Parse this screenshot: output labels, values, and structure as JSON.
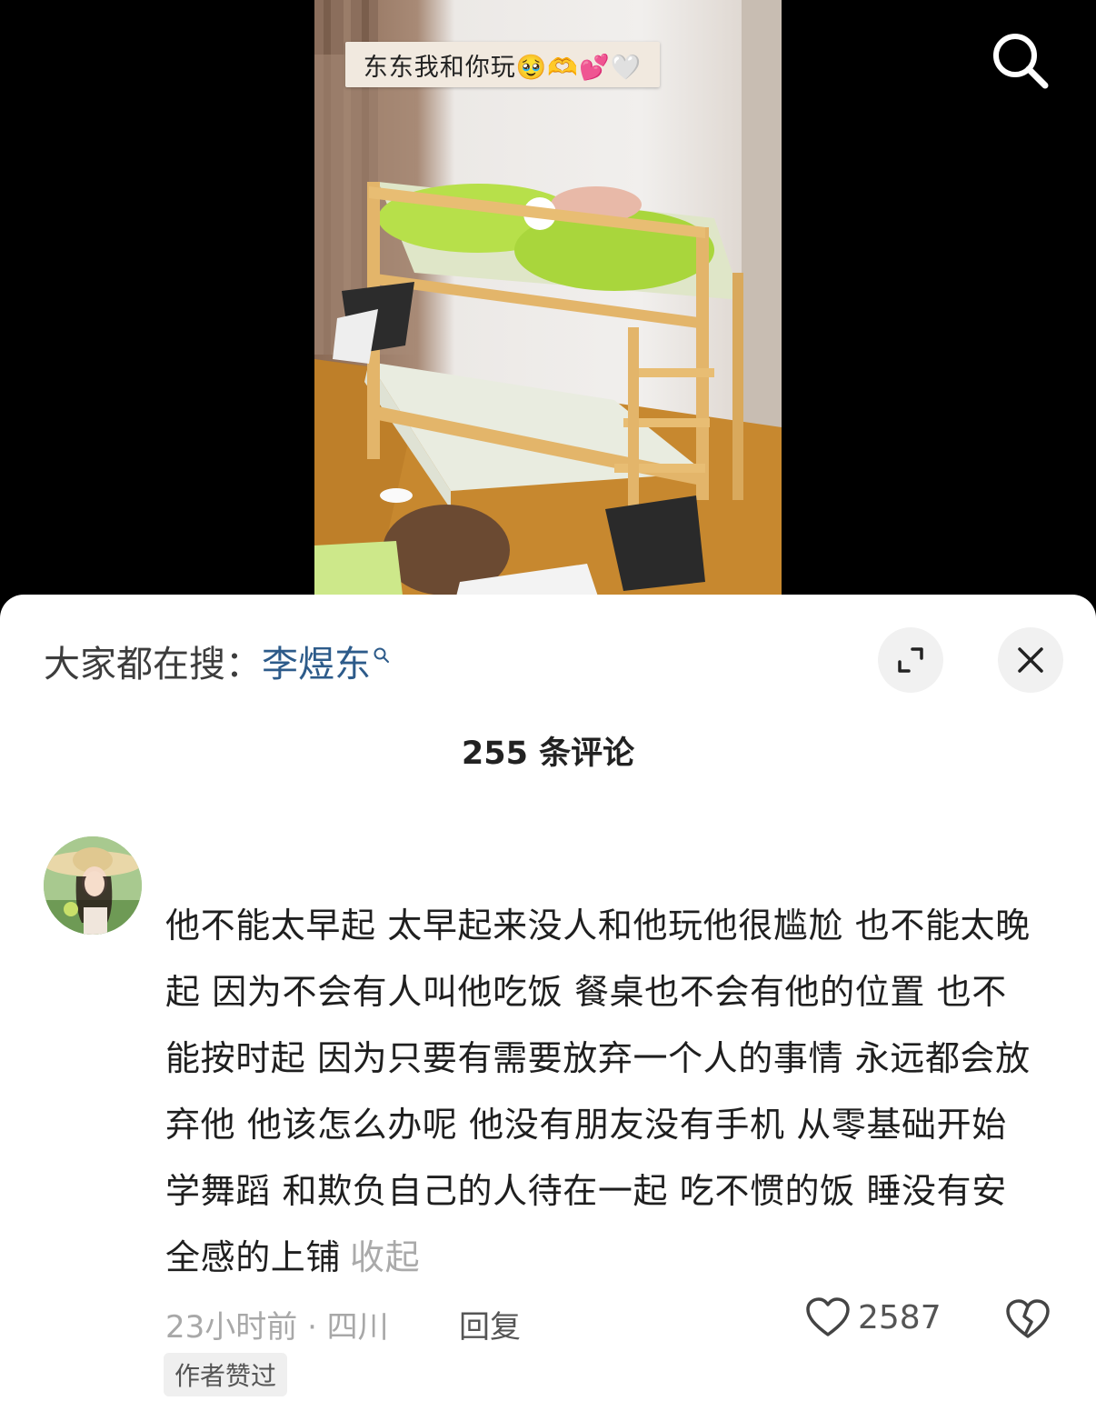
{
  "video": {
    "sticker_text": "东东我和你玩🥹🫶💕🤍"
  },
  "header": {
    "search_icon": "search-icon"
  },
  "sheet": {
    "hot_search_prefix": "大家都在搜：",
    "hot_search_keyword": "李煜东",
    "expand_icon": "expand-icon",
    "close_icon": "close-icon",
    "comment_count": "255 条评论"
  },
  "comment": {
    "text": "他不能太早起 太早起来没人和他玩他很尴尬 也不能太晚起 因为不会有人叫他吃饭 餐桌也不会有他的位置 也不能按时起 因为只要有需要放弃一个人的事情 永远都会放弃他 他该怎么办呢 他没有朋友没有手机 从零基础开始学舞蹈 和欺负自己的人待在一起 吃不惯的饭 睡没有安全感的上铺",
    "collapse_label": "收起",
    "time_location": "23小时前 · 四川",
    "reply_label": "回复",
    "like_count": "2587",
    "author_badge": "作者赞过"
  },
  "colors": {
    "keyword": "#2d5b8a",
    "muted": "#a8a8a8",
    "background": "#000000"
  }
}
